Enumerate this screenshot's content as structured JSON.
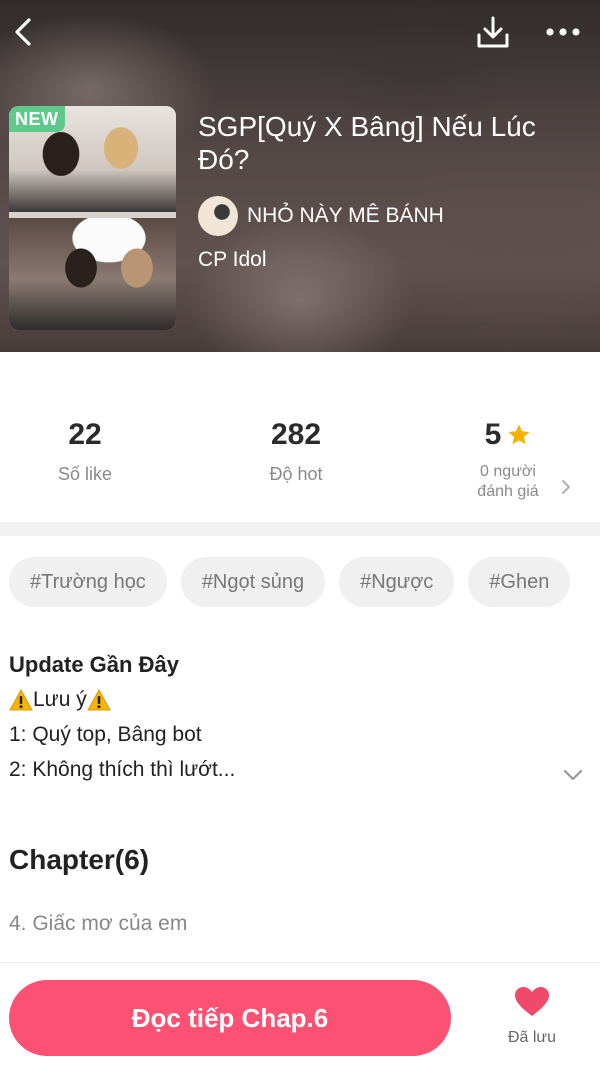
{
  "header": {
    "back_icon": "chevron-left-icon",
    "download_icon": "download-icon",
    "more_icon": "more-dots-icon"
  },
  "story": {
    "badge": "NEW",
    "title": "SGP[Quý X Bâng] Nếu Lúc Đó?",
    "author": "NHỎ NÀY MÊ BÁNH",
    "category": "CP Idol"
  },
  "stats": {
    "likes": {
      "value": "22",
      "label": "Số like"
    },
    "hot": {
      "value": "282",
      "label": "Độ hot"
    },
    "rating": {
      "value": "5",
      "label_line1": "0 người",
      "label_line2": "đánh giá",
      "star_color": "#f5b301"
    }
  },
  "tags": [
    "#Trường học",
    "#Ngọt sủng",
    "#Ngược",
    "#Ghen"
  ],
  "update": {
    "title": "Update Gần Đây",
    "note": "Lưu ý",
    "line1": "1: Quý top, Bâng bot",
    "line2": "2: Không thích thì lướt..."
  },
  "chapters": {
    "heading": "Chapter(6)",
    "latest": "4. Giấc mơ của em"
  },
  "actions": {
    "read_label": "Đọc tiếp Chap.6",
    "saved_label": "Đã lưu",
    "accent": "#fb5173",
    "heart_color": "#f04a6a"
  }
}
